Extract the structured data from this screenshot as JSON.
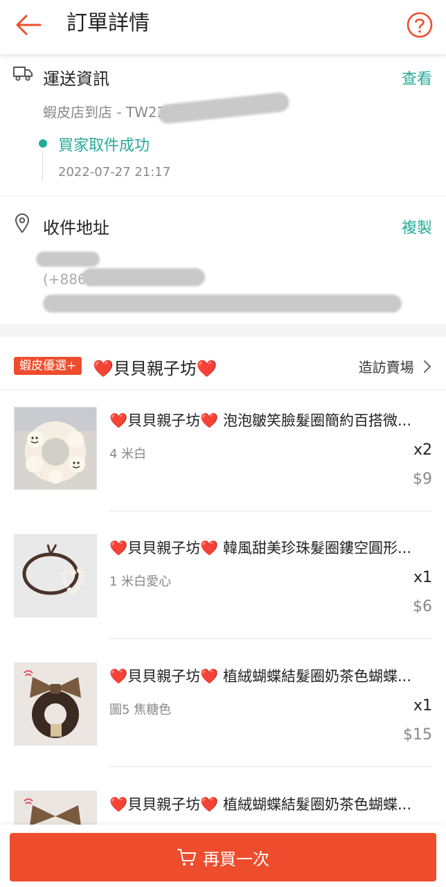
{
  "header": {
    "title": "訂單詳情",
    "back_icon": "arrow-left-icon",
    "help_icon": "question-circle-icon",
    "accent": "#ee4d2d"
  },
  "shipping": {
    "title": "運送資訊",
    "link": "查看",
    "carrier_label": "蝦皮店到店 - TW22687",
    "status": "買家取件成功",
    "status_time": "2022-07-27 21:17",
    "icon": "truck-icon"
  },
  "address": {
    "title": "收件地址",
    "link": "複製",
    "phone_prefix": "(+886)",
    "icon": "location-pin-icon"
  },
  "shop": {
    "badge": "蝦皮優選+",
    "name": "❤️貝貝親子坊❤️",
    "visit": "造訪賣場"
  },
  "items": [
    {
      "name": "❤️貝貝親子坊❤️ 泡泡皺笑臉髮圈簡約百搭微...",
      "variant": "4 米白",
      "qty": "x2",
      "price": "$9",
      "thumb": "white-scrunchie"
    },
    {
      "name": "❤️貝貝親子坊❤️ 韓風甜美珍珠髮圈鏤空圓形...",
      "variant": "1 米白愛心",
      "qty": "x1",
      "price": "$6",
      "thumb": "pearl-heart-hairtie"
    },
    {
      "name": "❤️貝貝親子坊❤️ 植絨蝴蝶結髮圈奶茶色蝴蝶...",
      "variant": "圖5 焦糖色",
      "qty": "x1",
      "price": "$15",
      "thumb": "brown-bow-scrunchie"
    },
    {
      "name": "❤️貝貝親子坊❤️ 植絨蝴蝶結髮圈奶茶色蝴蝶...",
      "variant": "",
      "qty": "",
      "price": "",
      "thumb": "brown-bow-scrunchie"
    }
  ],
  "footer": {
    "buy_again": "再買一次",
    "icon": "cart-icon"
  },
  "colors": {
    "primary": "#ee4d2d",
    "teal": "#26aa99",
    "muted_text": "#888888"
  }
}
